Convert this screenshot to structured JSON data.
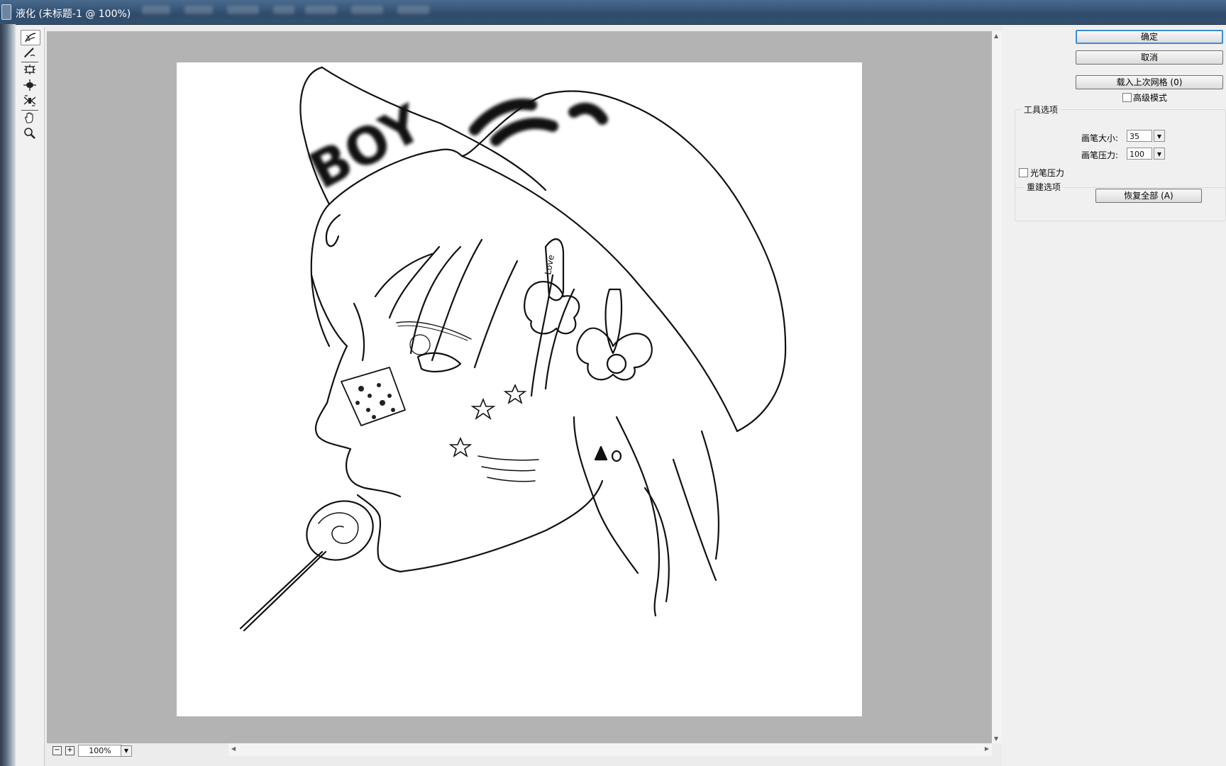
{
  "window": {
    "title": "液化 (未标题-1 @ 100%)"
  },
  "tools": [
    {
      "name": "forward-warp-tool",
      "active": true
    },
    {
      "name": "reconstruct-tool"
    },
    {
      "name": "pucker-tool"
    },
    {
      "name": "bloat-tool"
    },
    {
      "name": "push-left-tool"
    },
    {
      "name": "hand-tool"
    },
    {
      "name": "zoom-tool"
    }
  ],
  "buttons": {
    "ok": "确定",
    "cancel": "取消",
    "load_last_mesh": "载入上次网格 (0)",
    "restore_all": "恢复全部 (A)"
  },
  "advanced_mode": {
    "label": "高级模式",
    "checked": false
  },
  "tool_options": {
    "legend": "工具选项",
    "brush_size_label": "画笔大小:",
    "brush_size_value": "35",
    "brush_pressure_label": "画笔压力:",
    "brush_pressure_value": "100",
    "stylus_pressure_label": "光笔压力",
    "stylus_pressure_checked": false
  },
  "reconstruct_options": {
    "legend": "重建选项"
  },
  "zoom": {
    "value": "100%"
  },
  "artwork": {
    "cap_text_left": "BOY",
    "hairclip_text": "Love"
  },
  "colors": {
    "default_button_border": "#3b8ed8",
    "canvas_background": "#b3b3b3",
    "title_bar": "#2f4b6c"
  }
}
